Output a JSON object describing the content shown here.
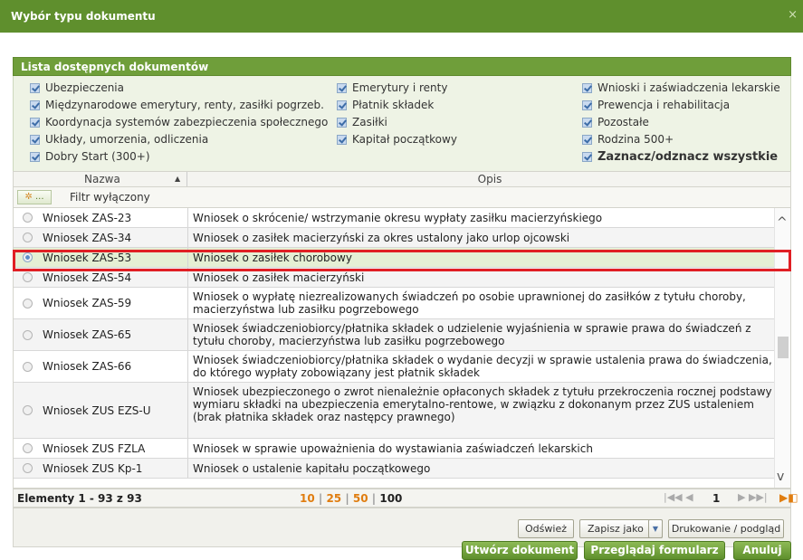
{
  "window": {
    "title": "Wybór typu dokumentu",
    "close_glyph": "×"
  },
  "panel": {
    "title": "Lista dostępnych dokumentów"
  },
  "filters": {
    "col1": [
      "Ubezpieczenia",
      "Międzynarodowe emerytury, renty, zasiłki pogrzeb.",
      "Koordynacja systemów zabezpieczenia społecznego",
      "Układy, umorzenia, odliczenia",
      "Dobry Start (300+)"
    ],
    "col2": [
      "Emerytury i renty",
      "Płatnik składek",
      "Zasiłki",
      "Kapitał początkowy"
    ],
    "col3": [
      "Wnioski i zaświadczenia lekarskie",
      "Prewencja i rehabilitacja",
      "Pozostałe",
      "Rodzina 500+"
    ],
    "toggle_all": "Zaznacz/odznacz wszystkie"
  },
  "columns": {
    "name": "Nazwa",
    "sort_glyph": "▲",
    "desc": "Opis"
  },
  "filter": {
    "button_label": "...",
    "status": "Filtr wyłączony"
  },
  "rows": [
    {
      "name": "Wniosek ZAS-23",
      "desc": "Wniosek o skrócenie/ wstrzymanie okresu wypłaty zasiłku macierzyńskiego"
    },
    {
      "name": "Wniosek ZAS-34",
      "desc": "Wniosek o zasiłek macierzyński za okres ustalony jako urlop ojcowski"
    },
    {
      "name": "Wniosek ZAS-53",
      "desc": "Wniosek o zasiłek chorobowy",
      "selected": true
    },
    {
      "name": "Wniosek ZAS-54",
      "desc": "Wniosek o zasiłek macierzyński"
    },
    {
      "name": "Wniosek ZAS-59",
      "desc": "Wniosek o wypłatę niezrealizowanych świadczeń po osobie uprawnionej do zasiłków z tytułu choroby, macierzyństwa lub zasiłku pogrzebowego"
    },
    {
      "name": "Wniosek ZAS-65",
      "desc": "Wniosek świadczeniobiorcy/płatnika składek o udzielenie wyjaśnienia w sprawie prawa do świadczeń z tytułu choroby, macierzyństwa lub zasiłku pogrzebowego"
    },
    {
      "name": "Wniosek ZAS-66",
      "desc": "Wniosek świadczeniobiorcy/płatnika składek o wydanie decyzji w sprawie ustalenia prawa do świadczenia, do którego wypłaty zobowiązany jest płatnik składek"
    },
    {
      "name": "Wniosek ZUS EZS-U",
      "desc": "Wniosek ubezpieczonego o zwrot nienależnie opłaconych składek z tytułu przekroczenia rocznej podstawy wymiaru składki na ubezpieczenia emerytalno-rentowe, w związku z dokonanym przez ZUS ustaleniem (brak płatnika składek oraz następcy prawnego)"
    },
    {
      "name": "Wniosek ZUS FZLA",
      "desc": "Wniosek w sprawie upoważnienia do wystawiania zaświadczeń lekarskich"
    },
    {
      "name": "Wniosek ZUS Kp-1",
      "desc": "Wniosek o ustalenie kapitału początkowego"
    }
  ],
  "scroll": {
    "up_glyph": "^",
    "down_glyph": "v"
  },
  "pager": {
    "count": "Elementy 1 - 93 z 93",
    "size1": "10",
    "sep1": " | ",
    "size2": "25",
    "sep2": " | ",
    "size3": "50",
    "sep3": " | ",
    "size4": "100",
    "prev_glyph": "|◀◀   ◀",
    "page": "1",
    "next_glyph": "▶  ▶▶|",
    "export_glyph": "▶◧"
  },
  "toolbar": {
    "refresh": "Odśwież",
    "save_as": "Zapisz jako",
    "dropdown_glyph": "▼",
    "print": "Drukowanie / podgląd"
  },
  "actions": {
    "create": "Utwórz dokument",
    "browse": "Przeglądaj formularz",
    "cancel": "Anuluj"
  },
  "colors": {
    "titlebar": "#5f8f2d",
    "panel_head": "#6f9e3a",
    "selection_border": "#e01f24",
    "page_size_active": "#e07d10"
  }
}
